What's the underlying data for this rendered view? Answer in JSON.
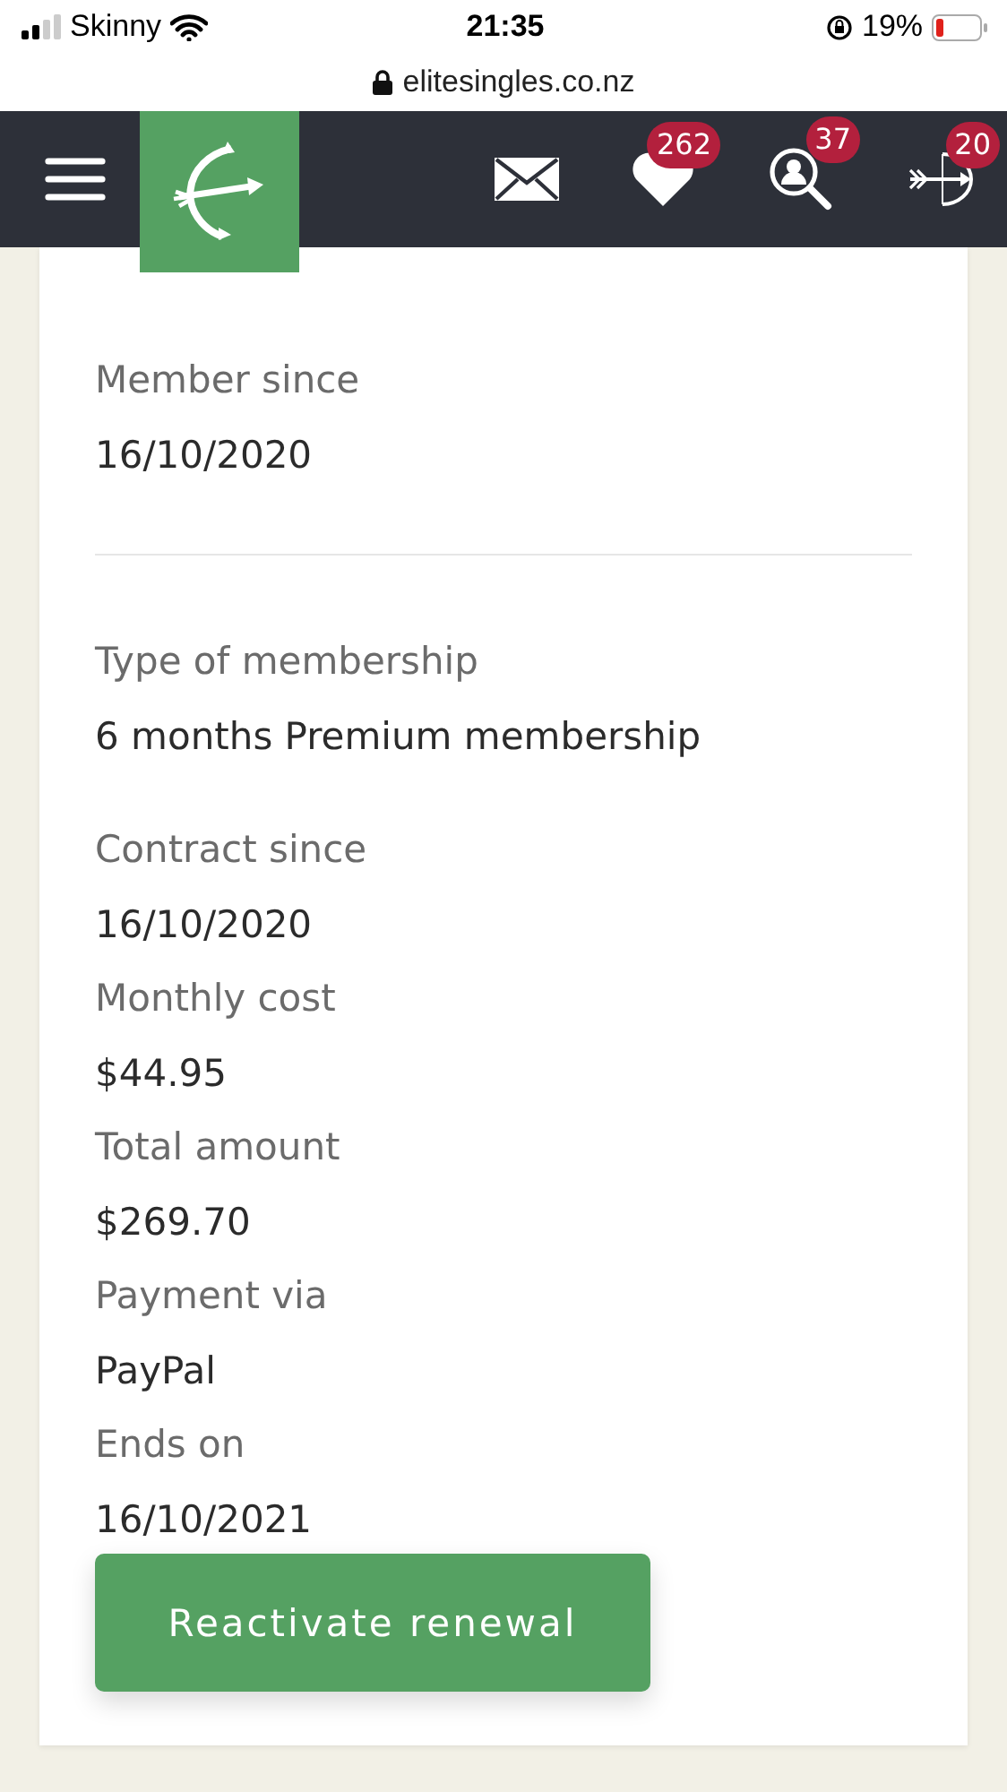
{
  "status_bar": {
    "carrier": "Skinny",
    "time": "21:35",
    "battery": "19%"
  },
  "address_bar": {
    "url": "elitesingles.co.nz"
  },
  "nav": {
    "badges": [
      {
        "kind": "likes",
        "count": "262"
      },
      {
        "kind": "visitors",
        "count": "37"
      },
      {
        "kind": "matches",
        "count": "20"
      }
    ]
  },
  "membership": {
    "sections": [
      {
        "fields": [
          {
            "label": "Member since",
            "value": "16/10/2020"
          }
        ]
      },
      {
        "fields": [
          {
            "label": "Type of membership",
            "value": "6 months Premium membership"
          },
          {
            "label": "Contract since",
            "value": "16/10/2020"
          },
          {
            "label": "Monthly cost",
            "value": "$44.95"
          },
          {
            "label": "Total amount",
            "value": "$269.70"
          },
          {
            "label": "Payment via",
            "value": "PayPal"
          },
          {
            "label": "Ends on",
            "value": "16/10/2021"
          }
        ]
      }
    ],
    "button": "Reactivate renewal"
  }
}
